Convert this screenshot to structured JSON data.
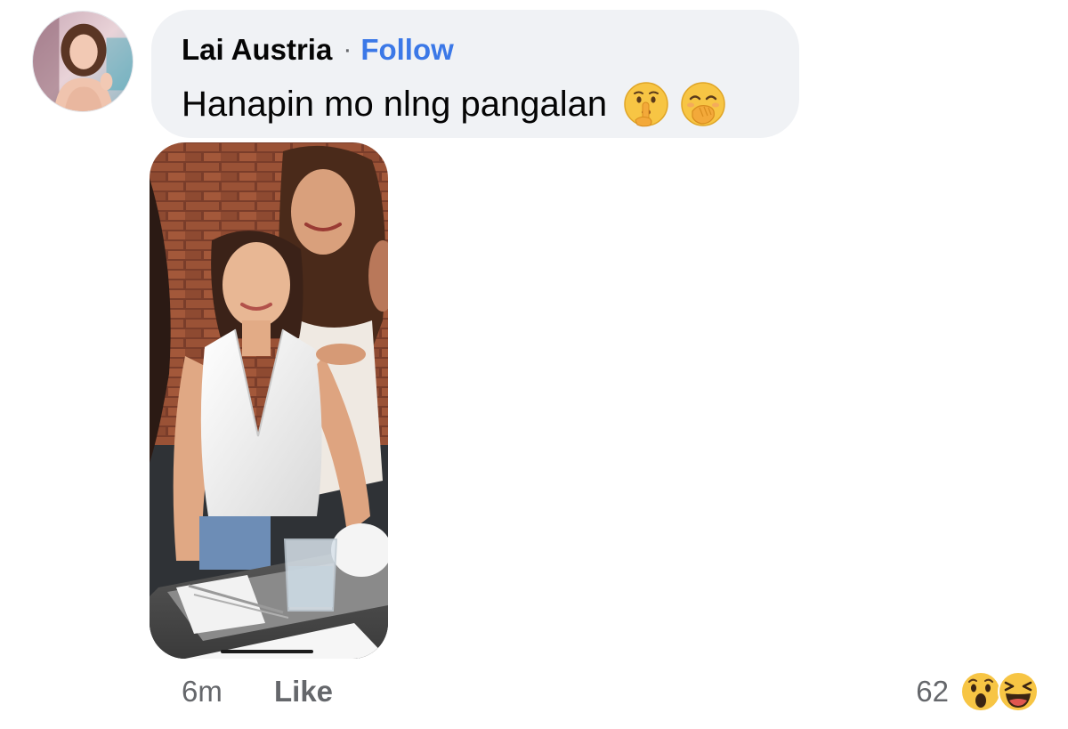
{
  "comment": {
    "author": "Lai Austria",
    "separator": "·",
    "follow_label": "Follow",
    "text": "Hanapin mo nlng pangalan",
    "text_emojis": [
      "shushing-face-icon",
      "face-with-hand-over-mouth-icon"
    ],
    "avatar": "profile-photo",
    "attachment": "photo-attachment"
  },
  "footer": {
    "time": "6m",
    "like_label": "Like",
    "reaction_count": "62",
    "reaction_icons": [
      "wow-reaction-icon",
      "haha-reaction-icon"
    ]
  },
  "colors": {
    "bubble_bg": "#f0f2f5",
    "link_blue": "#3b78e7",
    "secondary_text": "#65676b",
    "primary_text": "#050505",
    "emoji_yellow": "#f7c544"
  }
}
